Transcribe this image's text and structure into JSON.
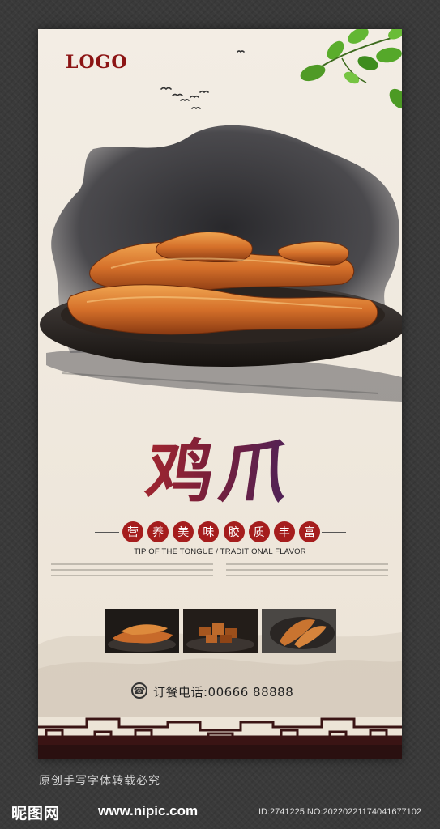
{
  "poster": {
    "logo": "LOGO",
    "title": "鸡爪",
    "slogan": [
      "营",
      "养",
      "美",
      "味",
      "胶",
      "质",
      "丰",
      "富"
    ],
    "subtitle": "TIP OF THE TONGUE / TRADITIONAL FLAVOR",
    "phone_label": "订餐电话:00666  88888"
  },
  "footer": {
    "note": "原创手写字体转载必究",
    "site_logo": "昵图网",
    "site_url": "www.nipic.com",
    "image_id": "ID:2741225 NO:20220221174041677102"
  },
  "colors": {
    "brand_red": "#8c1414",
    "badge_red": "#a51d1d",
    "paper": "#f3ede4",
    "ink": "#1e1e22"
  },
  "icons": [
    "bird-flock-icon",
    "leaf-branch-icon",
    "phone-icon"
  ]
}
